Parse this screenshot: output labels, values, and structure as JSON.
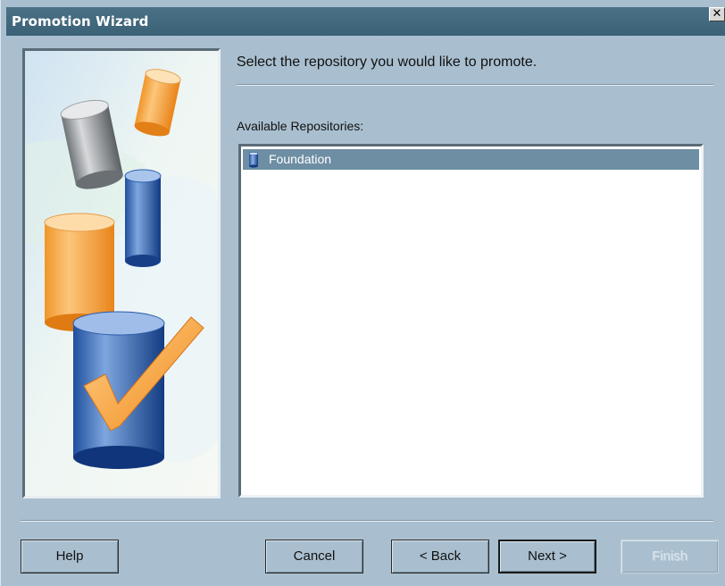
{
  "window": {
    "title": "Promotion Wizard",
    "close_glyph": "✕"
  },
  "icons": {
    "close": "close-icon",
    "repository": "repository-cylinder-icon",
    "wizard_illustration": "database-cylinders-checkmark-illustration"
  },
  "content": {
    "instruction": "Select the repository you would like to promote.",
    "list_label": "Available Repositories:",
    "repositories": [
      {
        "label": "Foundation",
        "selected": true
      }
    ]
  },
  "buttons": {
    "help": "Help",
    "cancel": "Cancel",
    "back": "< Back",
    "next": "Next >",
    "finish": "Finish"
  },
  "colors": {
    "dialog_background": "#a9bfcf",
    "title_bar": "#4a7186",
    "selection": "#6d8ea3"
  }
}
